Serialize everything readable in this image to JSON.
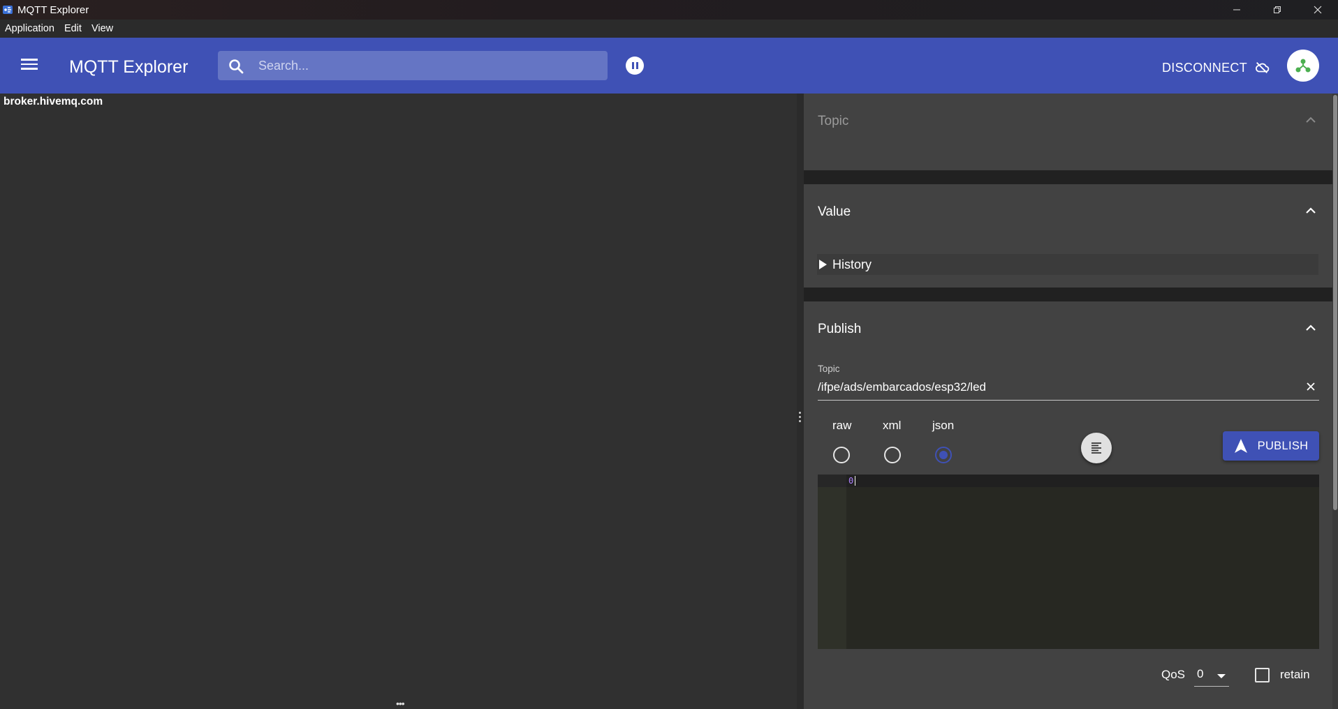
{
  "window": {
    "title": "MQTT Explorer",
    "minimize_glyph": "—",
    "maximize_glyph": "❐",
    "close_glyph": "✕"
  },
  "menubar": {
    "items": [
      "Application",
      "Edit",
      "View"
    ]
  },
  "appbar": {
    "title": "MQTT Explorer",
    "search_placeholder": "Search...",
    "disconnect_label": "DISCONNECT",
    "accent_color": "#3f51b5"
  },
  "tree": {
    "root_label": "broker.hivemq.com",
    "resize_handle": "•••"
  },
  "sidebar": {
    "topic_section_title": "Topic",
    "value_section_title": "Value",
    "history_label": "History",
    "publish_section_title": "Publish",
    "publish": {
      "topic_label": "Topic",
      "topic_value": "/ifpe/ads/embarcados/esp32/led",
      "formats": [
        "raw",
        "xml",
        "json"
      ],
      "selected_format": "json",
      "publish_label": "PUBLISH",
      "editor_line_number": "0",
      "qos_label": "QoS",
      "qos_value": "0",
      "retain_label": "retain",
      "retain_checked": false
    }
  },
  "icons": {
    "app": "mqtt-explorer-app-icon",
    "menu": "hamburger-menu-icon",
    "search": "search-icon",
    "pause": "pause-icon",
    "cloud_off": "cloud-off-icon",
    "avatar": "connection-hub-icon",
    "collapse": "chevron-up-icon",
    "clear": "close-icon",
    "format": "format-align-icon",
    "send": "send-icon"
  }
}
